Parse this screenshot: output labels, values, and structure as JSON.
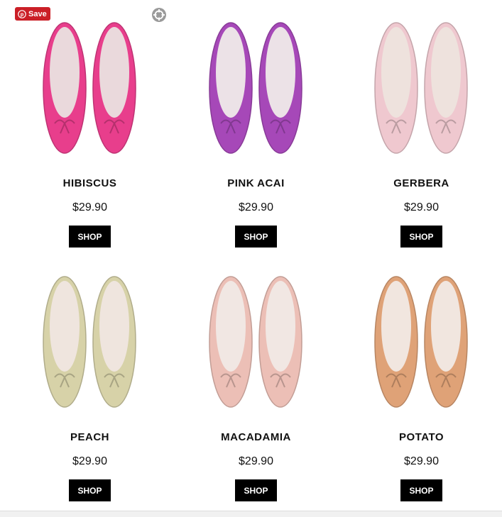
{
  "pin_button": {
    "label": "Save",
    "icon": "pinterest-icon",
    "color": "#cb1f27"
  },
  "zoom_icon": "crosshair-zoom-icon",
  "products": [
    {
      "name": "HIBISCUS",
      "price": "$29.90",
      "cta": "SHOP",
      "color": "#e83e8c",
      "inner": "#ead9dc"
    },
    {
      "name": "PINK ACAI",
      "price": "$29.90",
      "cta": "SHOP",
      "color": "#a648b8",
      "inner": "#ece2e7"
    },
    {
      "name": "GERBERA",
      "price": "$29.90",
      "cta": "SHOP",
      "color": "#efc8cf",
      "inner": "#eee2dd"
    },
    {
      "name": "PEACH",
      "price": "$29.90",
      "cta": "SHOP",
      "color": "#d7d2a8",
      "inner": "#efe5de"
    },
    {
      "name": "MACADAMIA",
      "price": "$29.90",
      "cta": "SHOP",
      "color": "#ecbfb6",
      "inner": "#f1e7e3"
    },
    {
      "name": "POTATO",
      "price": "$29.90",
      "cta": "SHOP",
      "color": "#dfa277",
      "inner": "#f1e6df"
    }
  ]
}
